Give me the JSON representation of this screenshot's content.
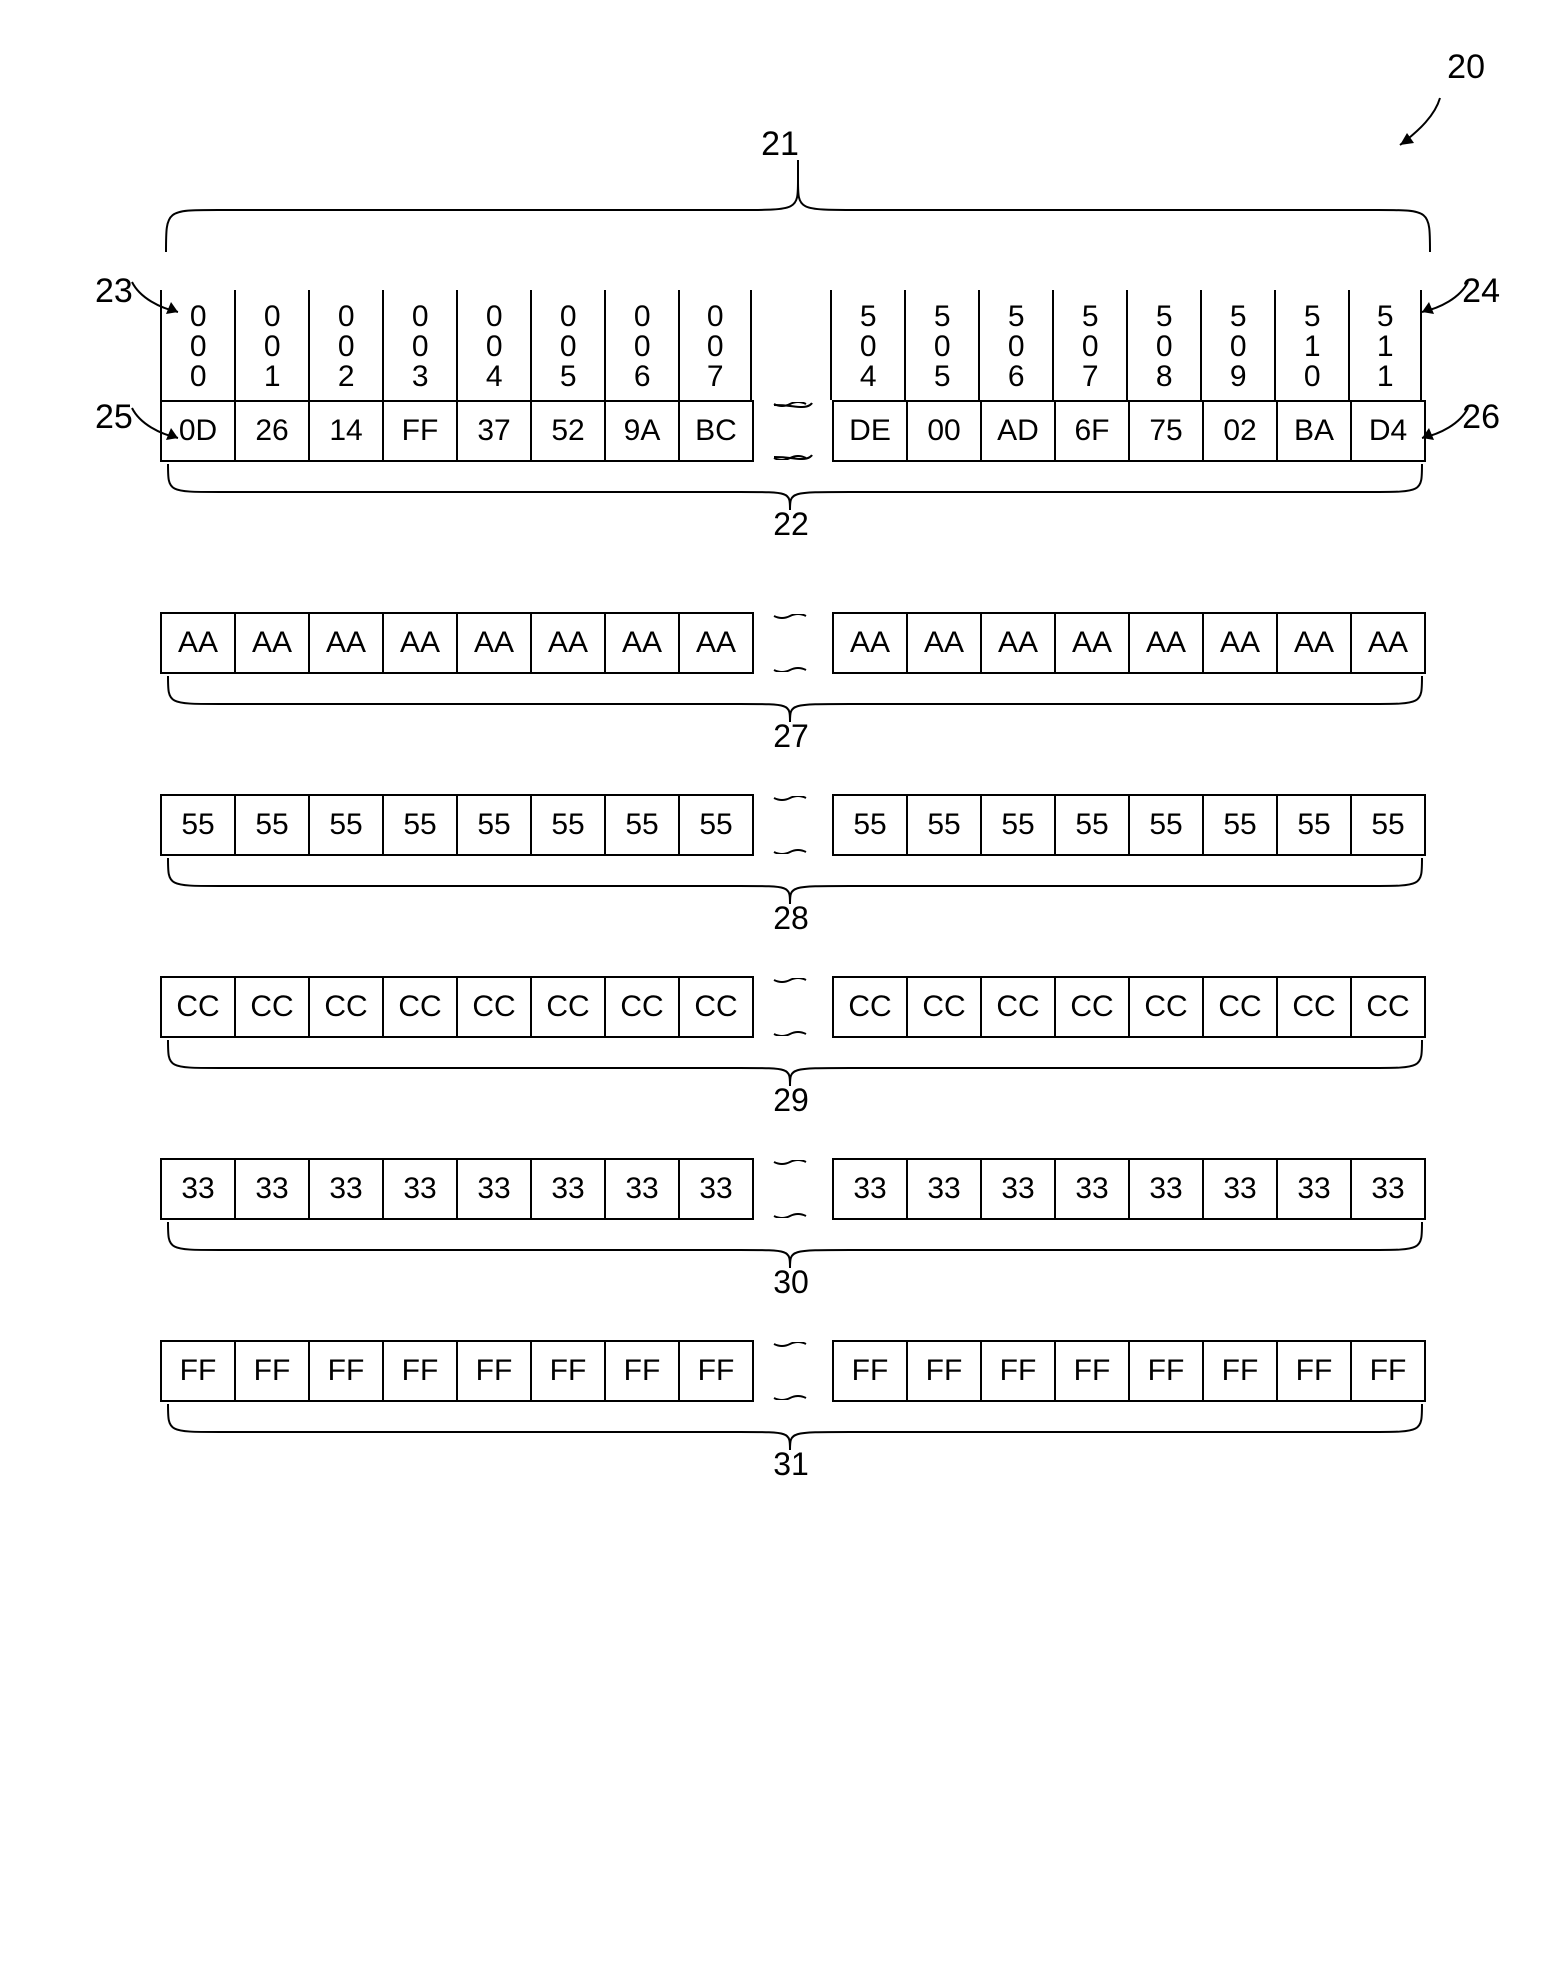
{
  "figure_label": "20",
  "callouts": {
    "top_brace": "21",
    "addr_row": {
      "left_arrow": "23",
      "right_arrow": "24",
      "left_cell_arrow": "25",
      "right_cell_arrow": "26"
    },
    "data_brace": "22",
    "pattern_braces": [
      "27",
      "28",
      "29",
      "30",
      "31"
    ]
  },
  "addresses": {
    "left": [
      "000",
      "001",
      "002",
      "003",
      "004",
      "005",
      "006",
      "007"
    ],
    "right": [
      "504",
      "505",
      "506",
      "507",
      "508",
      "509",
      "510",
      "511"
    ]
  },
  "data": {
    "left": [
      "0D",
      "26",
      "14",
      "FF",
      "37",
      "52",
      "9A",
      "BC"
    ],
    "right": [
      "DE",
      "00",
      "AD",
      "6F",
      "75",
      "02",
      "BA",
      "D4"
    ]
  },
  "patterns": [
    {
      "byte": "AA"
    },
    {
      "byte": "55"
    },
    {
      "byte": "CC"
    },
    {
      "byte": "33"
    },
    {
      "byte": "FF"
    }
  ]
}
